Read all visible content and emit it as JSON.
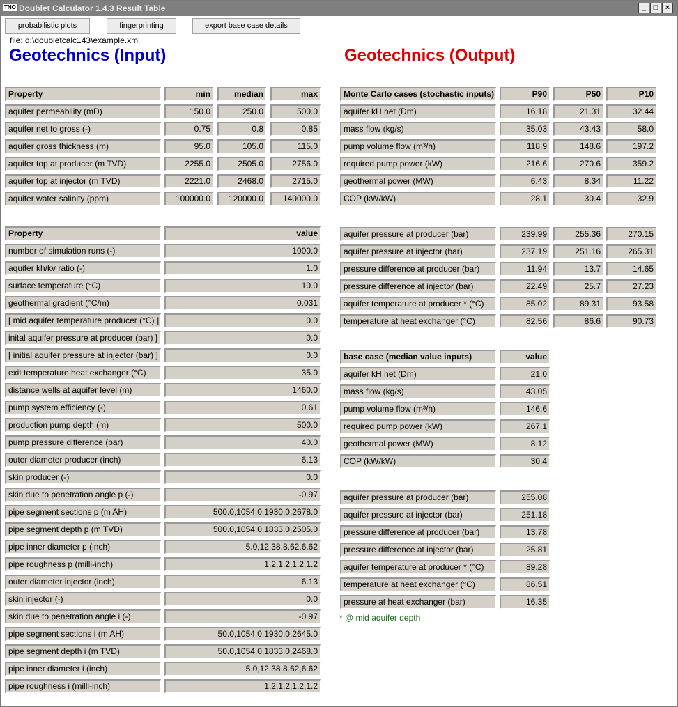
{
  "window": {
    "title": "Doublet Calculator 1.4.3 Result Table",
    "logo": "TNO",
    "min_glyph": "_",
    "max_glyph": "□",
    "close_glyph": "×"
  },
  "toolbar": {
    "probabilistic": "probabilistic plots",
    "fingerprinting": "fingerprinting",
    "export": "export base case details"
  },
  "file_label": "file:  d:\\doubletcalc143\\example.xml",
  "headings": {
    "input": "Geotechnics (Input)",
    "output": "Geotechnics (Output)",
    "input_color": "#0000cc",
    "output_color": "#e00000"
  },
  "input_table1": {
    "headers": [
      "Property",
      "min",
      "median",
      "max"
    ],
    "rows": [
      [
        "aquifer permeability (mD)",
        "150.0",
        "250.0",
        "500.0"
      ],
      [
        "aquifer net to gross (-)",
        "0.75",
        "0.8",
        "0.85"
      ],
      [
        "aquifer gross thickness (m)",
        "95.0",
        "105.0",
        "115.0"
      ],
      [
        "aquifer top at producer (m TVD)",
        "2255.0",
        "2505.0",
        "2756.0"
      ],
      [
        "aquifer top at injector (m TVD)",
        "2221.0",
        "2468.0",
        "2715.0"
      ],
      [
        "aquifer water salinity (ppm)",
        "100000.0",
        "120000.0",
        "140000.0"
      ]
    ]
  },
  "input_table2": {
    "headers": [
      "Property",
      "value"
    ],
    "rows": [
      [
        "number of simulation runs (-)",
        "1000.0"
      ],
      [
        "aquifer kh/kv ratio (-)",
        "1.0"
      ],
      [
        "surface temperature (°C)",
        "10.0"
      ],
      [
        "geothermal gradient (°C/m)",
        "0.031"
      ],
      [
        "[ mid aquifer temperature producer (°C) ]",
        "0.0"
      ],
      [
        "inital aquifer pressure at producer (bar) ]",
        "0.0"
      ],
      [
        "[ initial aquifer pressure at injector (bar) ]",
        "0.0"
      ],
      [
        "exit temperature heat exchanger (°C)",
        "35.0"
      ],
      [
        "distance wells at aquifer level (m)",
        "1460.0"
      ],
      [
        "pump system efficiency (-)",
        "0.61"
      ],
      [
        "production pump depth (m)",
        "500.0"
      ],
      [
        "pump pressure difference (bar)",
        "40.0"
      ],
      [
        "outer diameter producer (inch)",
        "6.13"
      ],
      [
        "skin producer (-)",
        "0.0"
      ],
      [
        "skin due to penetration angle p (-)",
        "-0.97"
      ],
      [
        "pipe segment sections p (m AH)",
        "500.0,1054.0,1930.0,2678.0"
      ],
      [
        "pipe segment depth p (m TVD)",
        "500.0,1054.0,1833.0,2505.0"
      ],
      [
        "pipe inner diameter p (inch)",
        "5.0,12.38,8.62,6.62"
      ],
      [
        "pipe roughness p (milli-inch)",
        "1.2,1.2,1.2,1.2"
      ],
      [
        "outer diameter injector (inch)",
        "6.13"
      ],
      [
        "skin injector (-)",
        "0.0"
      ],
      [
        "skin due to penetration angle i (-)",
        "-0.97"
      ],
      [
        "pipe segment sections i (m AH)",
        "50.0,1054.0,1930.0,2645.0"
      ],
      [
        "pipe segment depth i (m TVD)",
        "50.0,1054.0,1833.0,2468.0"
      ],
      [
        "pipe inner diameter i  (inch)",
        "5.0,12.38,8.62,6.62"
      ],
      [
        "pipe roughness i (milli-inch)",
        "1.2,1.2,1.2,1.2"
      ]
    ]
  },
  "output_table1": {
    "headers": [
      "Monte Carlo cases (stochastic inputs)",
      "P90",
      "P50",
      "P10"
    ],
    "rows": [
      [
        "aquifer kH net (Dm)",
        "16.18",
        "21.31",
        "32.44"
      ],
      [
        "mass flow (kg/s)",
        "35.03",
        "43.43",
        "58.0"
      ],
      [
        "pump volume flow (m³/h)",
        "118.9",
        "148.6",
        "197.2"
      ],
      [
        "required pump power (kW)",
        "216.6",
        "270.6",
        "359.2"
      ],
      [
        "geothermal power (MW)",
        "6.43",
        "8.34",
        "11.22"
      ],
      [
        "COP (kW/kW)",
        "28.1",
        "30.4",
        "32.9"
      ]
    ]
  },
  "output_table2": {
    "rows": [
      [
        "aquifer pressure at producer (bar)",
        "239.99",
        "255.36",
        "270.15"
      ],
      [
        "aquifer pressure at injector (bar)",
        "237.19",
        "251.16",
        "265.31"
      ],
      [
        "pressure difference at producer (bar)",
        "11.94",
        "13.7",
        "14.65"
      ],
      [
        "pressure difference at injector (bar)",
        "22.49",
        "25.7",
        "27.23"
      ],
      [
        "aquifer temperature at producer * (°C)",
        "85.02",
        "89.31",
        "93.58"
      ],
      [
        "temperature at heat exchanger (°C)",
        "82.56",
        "86.6",
        "90.73"
      ]
    ]
  },
  "base_table1": {
    "headers": [
      "base case (median value inputs)",
      "value"
    ],
    "rows": [
      [
        "aquifer kH net (Dm)",
        "21.0"
      ],
      [
        "mass flow (kg/s)",
        "43.05"
      ],
      [
        "pump volume flow (m³/h)",
        "146.6"
      ],
      [
        "required pump power (kW)",
        "267.1"
      ],
      [
        "geothermal power (MW)",
        "8.12"
      ],
      [
        "COP (kW/kW)",
        "30.4"
      ]
    ]
  },
  "base_table2": {
    "rows": [
      [
        "aquifer pressure at producer (bar)",
        "255.08"
      ],
      [
        "aquifer pressure at injector (bar)",
        "251.18"
      ],
      [
        "pressure difference at producer (bar)",
        "13.78"
      ],
      [
        "pressure difference at injector (bar)",
        "25.81"
      ],
      [
        "aquifer temperature at producer * (°C)",
        "89.28"
      ],
      [
        "temperature at heat exchanger (°C)",
        "86.51"
      ],
      [
        "pressure at heat exchanger (bar)",
        "16.35"
      ]
    ]
  },
  "footnote": "* @ mid aquifer depth"
}
